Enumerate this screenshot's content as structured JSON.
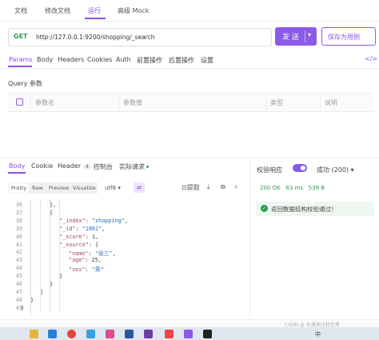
{
  "top_tabs": [
    "文档",
    "修改文档",
    "运行",
    "高级 Mock"
  ],
  "request": {
    "method": "GET",
    "url": "http://127.0.0.1:9200/shopping/_search",
    "send_label": "发 送",
    "save_label": "保存为用例"
  },
  "request_tabs": [
    "Params",
    "Body",
    "Headers",
    "Cookies",
    "Auth",
    "前置操作",
    "后置操作",
    "设置"
  ],
  "query": {
    "title": "Query 参数",
    "columns": [
      "参数名",
      "参数值",
      "类型",
      "说明"
    ]
  },
  "response": {
    "tabs": [
      "Body",
      "Cookie",
      "Header",
      "控制台",
      "实际请求"
    ],
    "header_count": "4",
    "formats": [
      "Pretty",
      "Raw",
      "Preview",
      "Visualize"
    ],
    "encoding": "utf8",
    "extract_label": "提取",
    "code_lines": [
      {
        "n": "36",
        "t": "},"
      },
      {
        "n": "37",
        "t": "{"
      },
      {
        "n": "38",
        "k": "\"_index\"",
        "v": "\"shopping\"",
        "e": ","
      },
      {
        "n": "39",
        "k": "\"_id\"",
        "v": "\"1001\"",
        "e": ","
      },
      {
        "n": "40",
        "k": "\"_score\"",
        "v": "1",
        "e": ","
      },
      {
        "n": "41",
        "k": "\"_source\"",
        "v": "{",
        "e": ""
      },
      {
        "n": "42",
        "k": "\"name\"",
        "v": "\"张三\"",
        "e": ","
      },
      {
        "n": "43",
        "k": "\"age\"",
        "v": "25",
        "e": ","
      },
      {
        "n": "44",
        "k": "\"sex\"",
        "v": "\"男\"",
        "e": ""
      },
      {
        "n": "45",
        "t": "}"
      },
      {
        "n": "46",
        "t": "}"
      },
      {
        "n": "47",
        "t": "]"
      },
      {
        "n": "48",
        "t": "}"
      },
      {
        "n": "49",
        "t": "}"
      }
    ]
  },
  "validation": {
    "label": "校验响应",
    "enabled": true,
    "result_label": "成功 (200)",
    "status": "200 OK",
    "time": "63 ms",
    "size": "539 B",
    "message": "返回数据结构校验通过！"
  },
  "watermark": "CSDN @ 水滴来比较优秀",
  "taskbar_text": "中"
}
